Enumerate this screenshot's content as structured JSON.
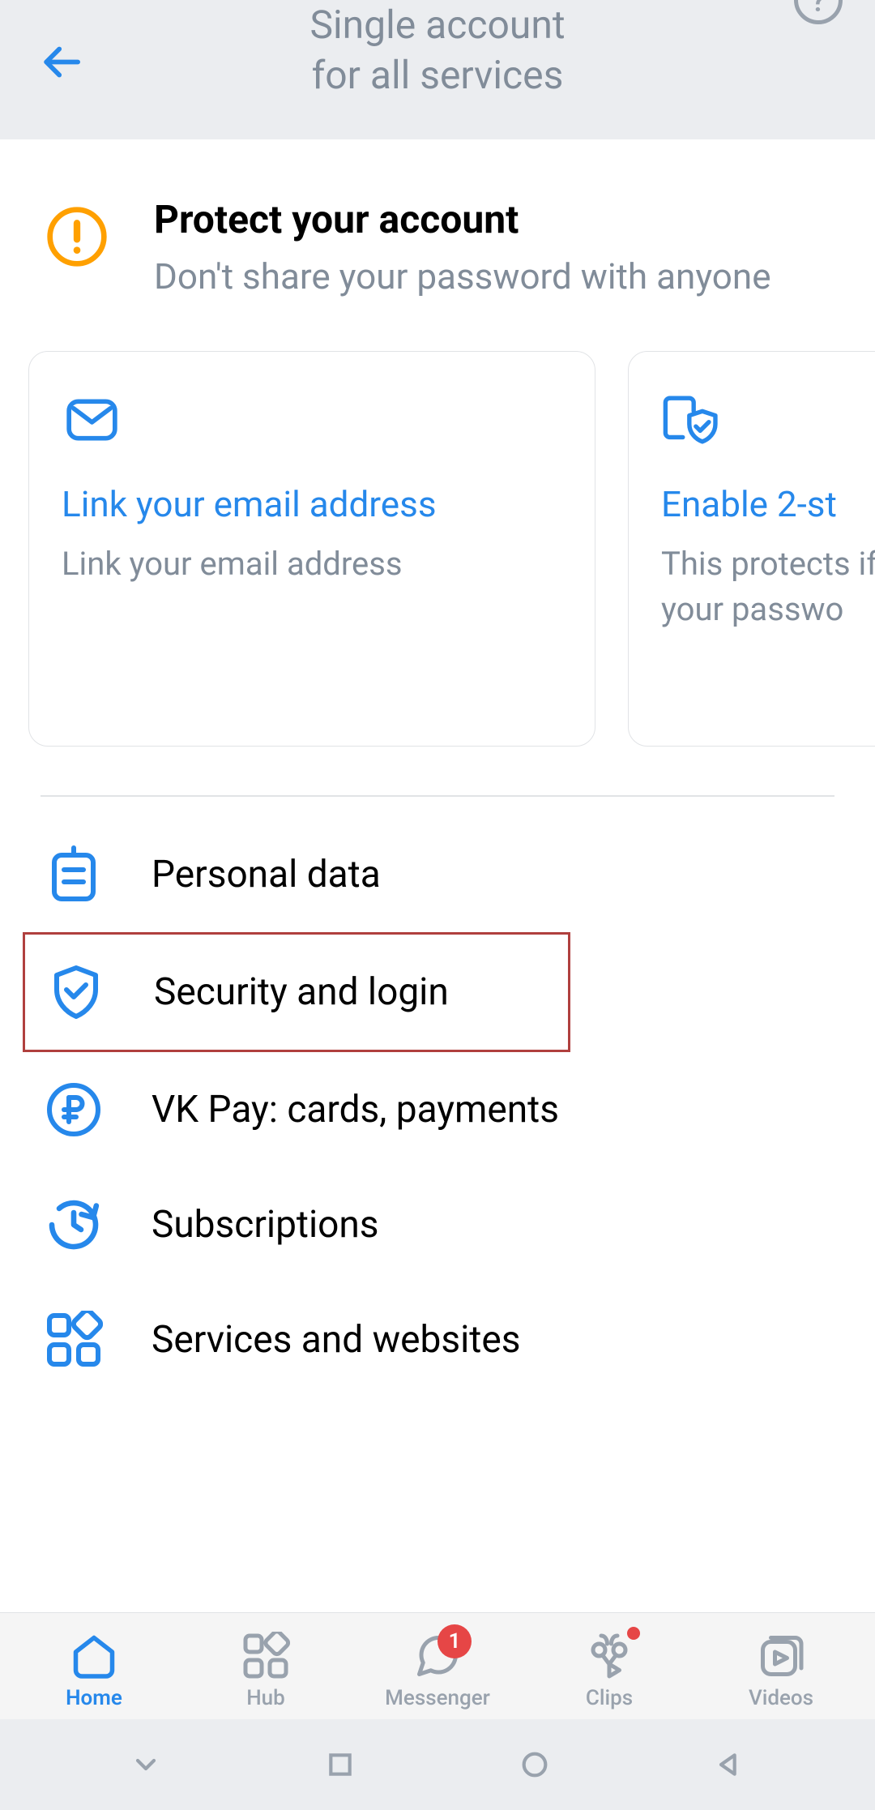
{
  "header": {
    "title_line1": "Single account",
    "title_line2": "for all services"
  },
  "protect": {
    "title": "Protect your account",
    "subtitle": "Don't share your password with anyone"
  },
  "cards": [
    {
      "title": "Link your email address",
      "subtitle": "Link your email address"
    },
    {
      "title": "Enable 2-st",
      "subtitle": "This protects if someone g your passwo"
    }
  ],
  "menu": [
    {
      "label": "Personal data"
    },
    {
      "label": "Security and login"
    },
    {
      "label": "VK Pay: cards, payments"
    },
    {
      "label": "Subscriptions"
    },
    {
      "label": "Services and websites"
    }
  ],
  "bottom_nav": {
    "home": "Home",
    "hub": "Hub",
    "messenger": "Messenger",
    "messenger_badge": "1",
    "clips": "Clips",
    "videos": "Videos"
  },
  "colors": {
    "accent": "#2688eb",
    "warning": "#ffa000",
    "muted": "#818c99",
    "highlight_border": "#b0403e",
    "badge": "#e64646"
  }
}
